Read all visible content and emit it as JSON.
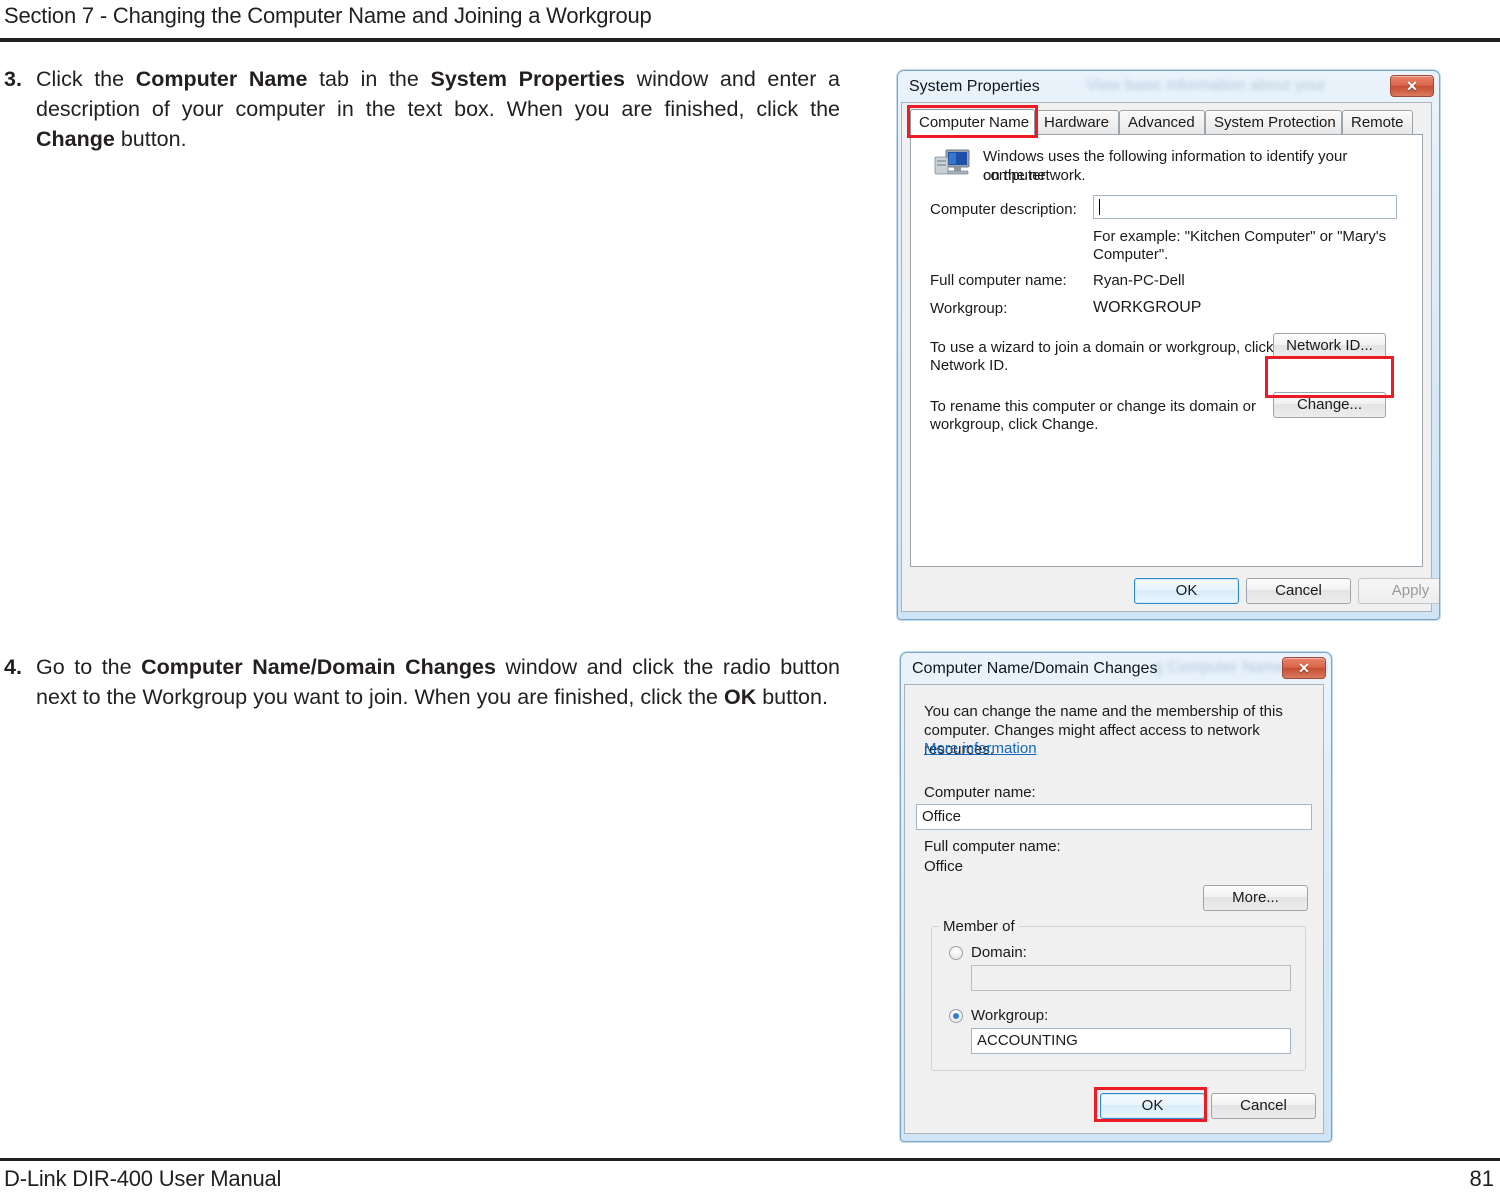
{
  "page": {
    "header": "Section 7 - Changing the Computer Name and Joining a Workgroup",
    "footer_left": "D-Link DIR-400 User Manual",
    "footer_page": "81"
  },
  "steps": [
    {
      "number": "3.",
      "text_parts": [
        {
          "t": "Click the ",
          "b": false
        },
        {
          "t": "Computer Name",
          "b": true
        },
        {
          "t": " tab in the ",
          "b": false
        },
        {
          "t": "System Properties",
          "b": true
        },
        {
          "t": " window and enter a description of your computer in the text box. When you are finished, click the ",
          "b": false
        },
        {
          "t": "Change",
          "b": true
        },
        {
          "t": " button.",
          "b": false
        }
      ],
      "line1": "Click the Computer Name tab in the System Properties window",
      "line2": "and enter a description of your computer in the text box. When",
      "line3": "you are finished, click the Change button."
    },
    {
      "number": "4.",
      "text_parts": [
        {
          "t": "Go to the ",
          "b": false
        },
        {
          "t": "Computer Name/Domain Changes",
          "b": true
        },
        {
          "t": " window and click the radio button next to the Workgroup you want to join. When you are finished, click the ",
          "b": false
        },
        {
          "t": "OK",
          "b": true
        },
        {
          "t": " button.",
          "b": false
        }
      ],
      "line1": "Go to the Computer Name/Domain Changes window and",
      "line2": "click the radio button next to the Workgroup you want to join.",
      "line3": "When you are finished, click the OK button."
    }
  ],
  "system_properties": {
    "title": "System Properties",
    "ghost_title": "View basic information about your",
    "close_label": "✕",
    "tabs": [
      {
        "label": "Computer Name",
        "active": true
      },
      {
        "label": "Hardware",
        "active": false
      },
      {
        "label": "Advanced",
        "active": false
      },
      {
        "label": "System Protection",
        "active": false
      },
      {
        "label": "Remote",
        "active": false
      }
    ],
    "intro_line1": "Windows uses the following information to identify your computer",
    "intro_line2": "on the network.",
    "computer_description_label": "Computer description:",
    "computer_description_value": "",
    "example_line1": "For example: \"Kitchen Computer\" or \"Mary's",
    "example_line2": "Computer\".",
    "full_computer_name_label": "Full computer name:",
    "full_computer_name_value": "Ryan-PC-Dell",
    "workgroup_label": "Workgroup:",
    "workgroup_value": "WORKGROUP",
    "network_id_text_line1": "To use a wizard to join a domain or workgroup, click",
    "network_id_text_line2": "Network ID.",
    "network_id_button": "Network ID...",
    "change_text_line1": "To rename this computer or change its domain or",
    "change_text_line2": "workgroup, click Change.",
    "change_button": "Change...",
    "ok_button": "OK",
    "cancel_button": "Cancel",
    "apply_button": "Apply"
  },
  "domain_changes": {
    "title": "Computer Name/Domain Changes",
    "ghost_title": "g Computer Name Properties",
    "close_label": "✕",
    "intro_line1": "You can change the name and the membership of this",
    "intro_line2": "computer. Changes might affect access to network resources.",
    "more_information_link": "More information",
    "computer_name_label": "Computer name:",
    "computer_name_value": "Office",
    "full_computer_name_label": "Full computer name:",
    "full_computer_name_value": "Office",
    "more_button": "More...",
    "member_of_label": "Member of",
    "domain_label": "Domain:",
    "domain_value": "",
    "domain_selected": false,
    "workgroup_label": "Workgroup:",
    "workgroup_value": "ACCOUNTING",
    "workgroup_selected": true,
    "ok_button": "OK",
    "cancel_button": "Cancel"
  },
  "colors": {
    "highlight": "#ec1c24",
    "link": "#1566c0",
    "accent": "#2b7fd4",
    "text": "#231f20"
  }
}
